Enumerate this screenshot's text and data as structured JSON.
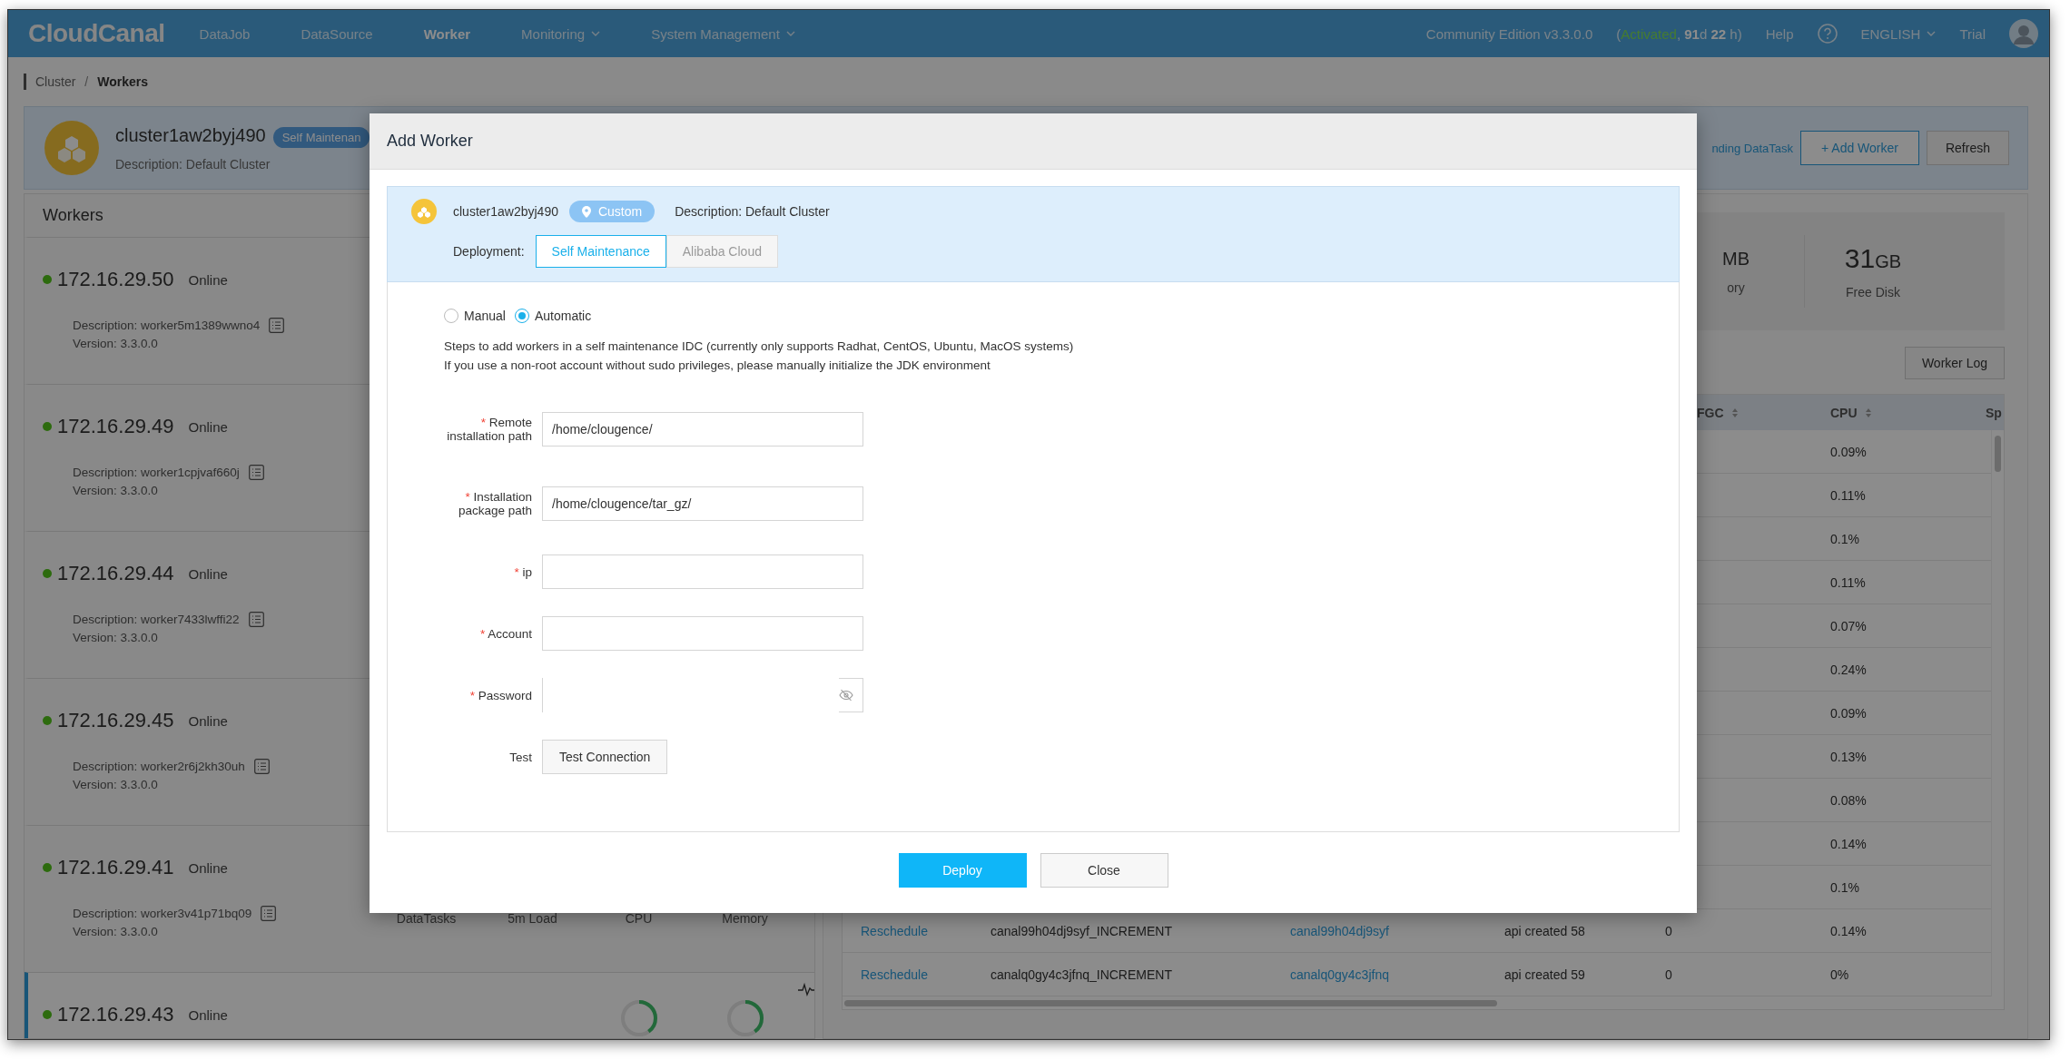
{
  "nav": {
    "logo": "CloudCanal",
    "items": [
      {
        "label": "DataJob",
        "selected": false,
        "dropdown": false
      },
      {
        "label": "DataSource",
        "selected": false,
        "dropdown": false
      },
      {
        "label": "Worker",
        "selected": true,
        "dropdown": false
      },
      {
        "label": "Monitoring",
        "selected": false,
        "dropdown": true
      },
      {
        "label": "System Management",
        "selected": false,
        "dropdown": true
      }
    ],
    "edition": "Community Edition v3.3.0.0",
    "license_prefix": "(",
    "license_status": "Activated",
    "license_rest": ", **91**d **22** h)",
    "help": "Help",
    "language": "ENGLISH",
    "user": "Trial"
  },
  "breadcrumb": {
    "items": [
      "Cluster",
      "Workers"
    ],
    "separator": "/"
  },
  "cluster": {
    "name": "cluster1aw2byj490",
    "tag": "Self Maintenan",
    "description": "Description: Default Cluster",
    "link": "nding DataTask",
    "buttons": [
      "+ Add Worker",
      "Refresh"
    ]
  },
  "workers": {
    "title": "Workers",
    "items": [
      {
        "ip": "172.16.29.50",
        "status": "Online",
        "description": "Description: worker5m1389wwno4",
        "version": "Version: 3.3.0.0",
        "selected": false
      },
      {
        "ip": "172.16.29.49",
        "status": "Online",
        "description": "Description: worker1cpjvaf660j",
        "version": "Version: 3.3.0.0",
        "selected": false
      },
      {
        "ip": "172.16.29.44",
        "status": "Online",
        "description": "Description: worker7433lwffi22",
        "version": "Version: 3.3.0.0",
        "selected": false
      },
      {
        "ip": "172.16.29.45",
        "status": "Online",
        "description": "Description: worker2r6j2kh30uh",
        "version": "Version: 3.3.0.0",
        "selected": false
      },
      {
        "ip": "172.16.29.41",
        "status": "Online",
        "description": "Description: worker3v41p71bq09",
        "version": "Version: 3.3.0.0",
        "selected": false,
        "stats": {
          "kind": "labels",
          "labels": [
            "DataTasks",
            "5m Load",
            "CPU",
            "Memory"
          ]
        }
      },
      {
        "ip": "172.16.29.43",
        "status": "Online",
        "selected": true,
        "stats": {
          "kind": "gauges",
          "gauges": [
            {
              "level": 0.4
            },
            {
              "level": 0.4
            }
          ]
        }
      }
    ]
  },
  "detail": {
    "stats": [
      {
        "unit": "MB",
        "label": "ory"
      },
      {
        "value": "31",
        "unit": "GB",
        "label": "Free Disk"
      }
    ],
    "worker_log": "Worker Log",
    "table": {
      "columns": [
        {
          "label": "FGC",
          "sortable": true
        },
        {
          "label": "CPU",
          "sortable": true
        },
        {
          "label": "Sp",
          "sortable": false
        }
      ],
      "rows": [
        {
          "cpu": "0.09%"
        },
        {
          "cpu": "0.11%"
        },
        {
          "cpu": "0.1%"
        },
        {
          "cpu": "0.11%"
        },
        {
          "cpu": "0.07%"
        },
        {
          "cpu": "0.24%"
        },
        {
          "cpu": "0.09%"
        },
        {
          "cpu": "0.13%"
        },
        {
          "cpu": "0.08%"
        },
        {
          "cpu": "0.14%"
        },
        {
          "cpu": "0.1%"
        },
        {
          "action": "Reschedule",
          "name": "canal99h04dj9syf_INCREMENT",
          "link": "canal99h04dj9syf",
          "column_4": "api created 58",
          "fgc": "0",
          "cpu": "0.14%"
        },
        {
          "action": "Reschedule",
          "name": "canalq0gy4c3jfnq_INCREMENT",
          "link": "canalq0gy4c3jfnq",
          "column_4": "api created 59",
          "fgc": "0",
          "cpu": "0%"
        }
      ]
    }
  },
  "dialog": {
    "title": "Add Worker",
    "cluster_name": "cluster1aw2byj490",
    "tag": "Custom",
    "description": "Description: Default Cluster",
    "deployment_label": "Deployment:",
    "deployment_tabs": [
      {
        "label": "Self Maintenance",
        "selected": true,
        "disabled": false
      },
      {
        "label": "Alibaba Cloud",
        "selected": false,
        "disabled": true
      }
    ],
    "modes": [
      {
        "label": "Manual",
        "selected": false
      },
      {
        "label": "Automatic",
        "selected": true
      }
    ],
    "notes": [
      "Steps to add workers in a self maintenance IDC (currently only supports Radhat, CentOS, Ubuntu, MacOS systems)",
      "If you use a non-root account without sudo privileges, please manually initialize the JDK environment"
    ],
    "fields": [
      {
        "kind": "text",
        "mark": "*",
        "label": "Remote installation path",
        "value": "/home/clougence/"
      },
      {
        "kind": "text",
        "mark": "*",
        "label": "Installation package path",
        "value": "/home/clougence/tar_gz/"
      },
      {
        "kind": "text",
        "mark": "*",
        "label": "ip"
      },
      {
        "kind": "text",
        "mark": "*",
        "label": "Account"
      },
      {
        "kind": "password",
        "mark": "*",
        "label": "Password"
      },
      {
        "kind": "button",
        "label": "Test",
        "button": "Test Connection"
      }
    ],
    "buttons": [
      {
        "kind": "primary",
        "label": "Deploy"
      },
      {
        "kind": "default",
        "label": "Close"
      }
    ]
  }
}
